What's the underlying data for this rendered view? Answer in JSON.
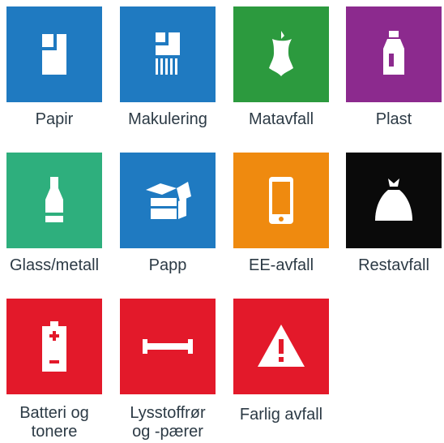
{
  "categories": [
    {
      "label": "Papir",
      "icon": "paper-icon",
      "color": "#1f7ac1"
    },
    {
      "label": "Makulering",
      "icon": "shredded-paper-icon",
      "color": "#1f7ac1"
    },
    {
      "label": "Matavfall",
      "icon": "apple-core-icon",
      "color": "#2c9a3e"
    },
    {
      "label": "Plast",
      "icon": "plastic-bottle-icon",
      "color": "#8c2a8e"
    },
    {
      "label": "Glass/metall",
      "icon": "glass-bottle-icon",
      "color": "#2eaf7d"
    },
    {
      "label": "Papp",
      "icon": "cardboard-box-icon",
      "color": "#1f7ac1"
    },
    {
      "label": "EE-avfall",
      "icon": "phone-icon",
      "color": "#ef8a0f"
    },
    {
      "label": "Restavfall",
      "icon": "trash-bag-icon",
      "color": "#0a0a0a"
    },
    {
      "label_lines": [
        "Batteri og",
        "tonere"
      ],
      "icon": "battery-icon",
      "color": "#e3192a"
    },
    {
      "label_lines": [
        "Lysstoffrør",
        "og -pærer"
      ],
      "icon": "fluorescent-tube-icon",
      "color": "#e3192a"
    },
    {
      "label": "Farlig avfall",
      "icon": "warning-triangle-icon",
      "color": "#e3192a"
    }
  ]
}
